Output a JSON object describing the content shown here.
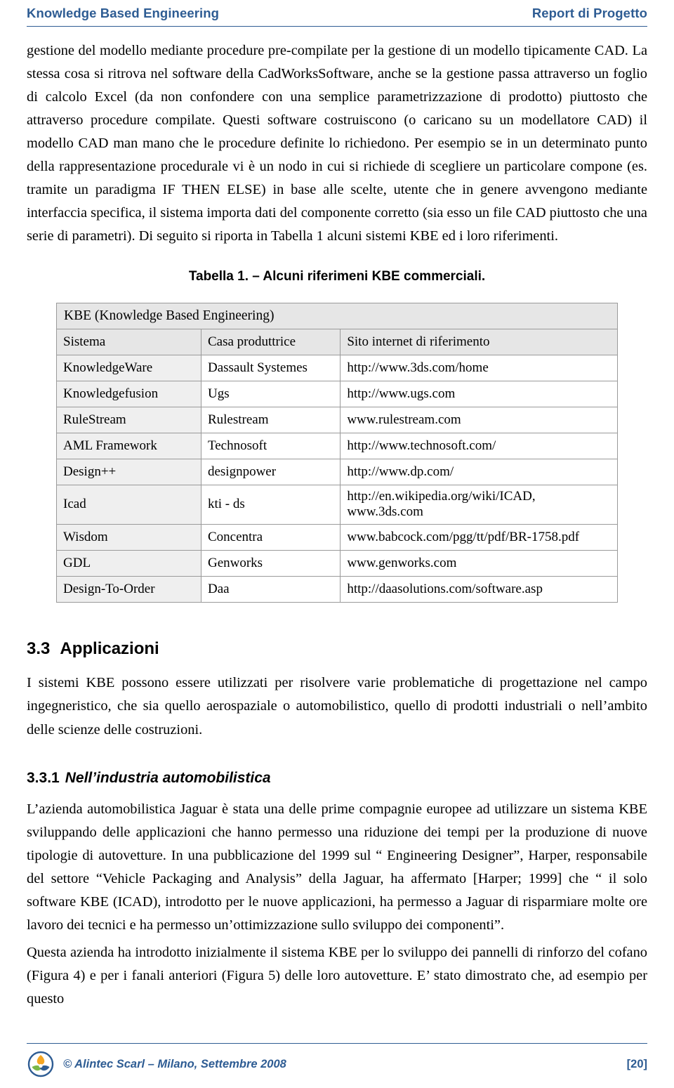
{
  "header": {
    "left": "Knowledge Based Engineering",
    "right": "Report di Progetto",
    "rule_color": "#2E5C93"
  },
  "body": {
    "paragraph1": "gestione del modello mediante procedure pre-compilate per la gestione di un modello tipicamente CAD. La stessa cosa si ritrova nel software della CadWorksSoftware, anche se la gestione passa attraverso un foglio di calcolo Excel (da non confondere con una semplice parametrizzazione di prodotto) piuttosto che attraverso procedure compilate. Questi software costruiscono (o caricano su un modellatore CAD) il modello CAD man mano che le procedure definite lo richiedono. Per esempio se in un determinato punto della rappresentazione procedurale vi è un nodo in cui si richiede di scegliere un particolare compone (es. tramite un paradigma IF THEN ELSE) in base alle scelte, utente che in genere avvengono mediante interfaccia specifica, il sistema importa dati del componente corretto (sia esso un file CAD piuttosto che una serie di parametri). Di seguito si riporta in Tabella 1 alcuni sistemi KBE ed i loro riferimenti."
  },
  "table": {
    "caption": "Tabella 1. – Alcuni riferimeni KBE commerciali.",
    "title": "KBE (Knowledge Based Engineering)",
    "headers": [
      "Sistema",
      "Casa produttrice",
      "Sito internet di riferimento"
    ],
    "rows": [
      [
        "KnowledgeWare",
        "Dassault Systemes",
        "http://www.3ds.com/home"
      ],
      [
        "Knowledgefusion",
        "Ugs",
        "http://www.ugs.com"
      ],
      [
        "RuleStream",
        "Rulestream",
        "www.rulestream.com"
      ],
      [
        "AML Framework",
        "Technosoft",
        "http://www.technosoft.com/"
      ],
      [
        "Design++",
        "designpower",
        "http://www.dp.com/"
      ],
      [
        "Icad",
        "kti - ds",
        "http://en.wikipedia.org/wiki/ICAD, www.3ds.com"
      ],
      [
        "Wisdom",
        "Concentra",
        "www.babcock.com/pgg/tt/pdf/BR-1758.pdf"
      ],
      [
        "GDL",
        "Genworks",
        "www.genworks.com"
      ],
      [
        "Design-To-Order",
        "Daa",
        "http://daasolutions.com/software.asp"
      ]
    ]
  },
  "sections": {
    "s33_num": "3.3",
    "s33_title": "Applicazioni",
    "s33_text": "I sistemi KBE possono essere utilizzati per risolvere varie problematiche di progettazione nel campo ingegneristico, che sia quello aerospaziale o automobilistico, quello di prodotti industriali o nell’ambito delle scienze delle costruzioni.",
    "s331_num": "3.3.1",
    "s331_title": "Nell’industria automobilistica",
    "s331_text1": "L’azienda automobilistica Jaguar è stata una delle prime compagnie europee ad utilizzare un sistema KBE sviluppando delle applicazioni che hanno permesso una riduzione dei tempi per la produzione di nuove tipologie di autovetture. In una pubblicazione del 1999 sul “ Engineering Designer”, Harper, responsabile del settore “Vehicle Packaging and Analysis” della Jaguar, ha affermato [Harper; 1999] che “ il solo software KBE (ICAD), introdotto per le nuove applicazioni, ha permesso a Jaguar di risparmiare molte ore lavoro dei tecnici e ha permesso un’ottimizzazione sullo sviluppo dei componenti”.",
    "s331_text2": "Questa azienda ha introdotto inizialmente il sistema KBE per lo sviluppo dei pannelli di rinforzo del cofano (Figura 4) e per i fanali anteriori (Figura 5) delle loro autovetture. E’ stato dimostrato che, ad esempio per questo"
  },
  "footer": {
    "text": "© Alintec Scarl – Milano, Settembre 2008",
    "page": "[20]",
    "color": "#2E5C93"
  }
}
